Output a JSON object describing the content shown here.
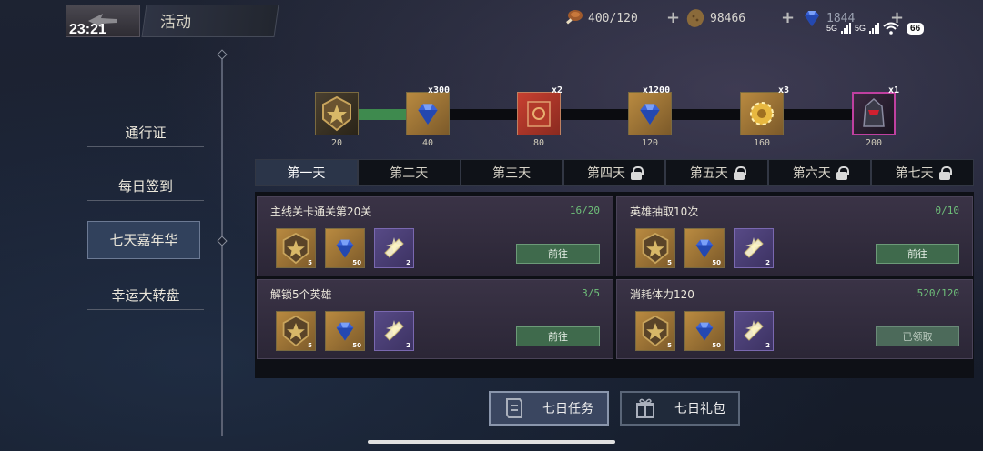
{
  "status_bar": {
    "time": "23:21",
    "network1": "5G",
    "network2": "5G",
    "battery": "66"
  },
  "header": {
    "title": "活动"
  },
  "resources": [
    {
      "icon": "meat-icon",
      "value": "400/120"
    },
    {
      "icon": "potato-coin-icon",
      "value": "98466"
    },
    {
      "icon": "diamond-icon",
      "value": "1844"
    }
  ],
  "sidebar": {
    "items": [
      {
        "label": "通行证",
        "active": false
      },
      {
        "label": "每日签到",
        "active": false
      },
      {
        "label": "七天嘉年华",
        "active": true
      },
      {
        "label": "幸运大转盘",
        "active": false
      }
    ]
  },
  "milestones": [
    {
      "icon": "star-medal-icon",
      "mult": "",
      "points": "20"
    },
    {
      "icon": "diamond-icon",
      "mult": "x300",
      "points": "40"
    },
    {
      "icon": "red-book-icon",
      "mult": "x2",
      "points": "80"
    },
    {
      "icon": "diamond-icon",
      "mult": "x1200",
      "points": "120"
    },
    {
      "icon": "gold-gear-icon",
      "mult": "x3",
      "points": "160"
    },
    {
      "icon": "dark-knight-icon",
      "mult": "x1",
      "points": "200"
    }
  ],
  "progress_fraction": 0.1,
  "day_tabs": [
    {
      "label": "第一天",
      "locked": false,
      "active": true
    },
    {
      "label": "第二天",
      "locked": false,
      "active": false
    },
    {
      "label": "第三天",
      "locked": false,
      "active": false
    },
    {
      "label": "第四天",
      "locked": true,
      "active": false
    },
    {
      "label": "第五天",
      "locked": true,
      "active": false
    },
    {
      "label": "第六天",
      "locked": true,
      "active": false
    },
    {
      "label": "第七天",
      "locked": true,
      "active": false
    }
  ],
  "tasks": [
    {
      "name": "主线关卡通关第20关",
      "progress": "16/20",
      "button": "前往",
      "done": false,
      "rewards": [
        {
          "icon": "star-medal-icon",
          "count": "5"
        },
        {
          "icon": "diamond-icon",
          "count": "50"
        },
        {
          "icon": "scroll-icon",
          "count": "2"
        }
      ]
    },
    {
      "name": "英雄抽取10次",
      "progress": "0/10",
      "button": "前往",
      "done": false,
      "rewards": [
        {
          "icon": "star-medal-icon",
          "count": "5"
        },
        {
          "icon": "diamond-icon",
          "count": "50"
        },
        {
          "icon": "scroll-icon",
          "count": "2"
        }
      ]
    },
    {
      "name": "解锁5个英雄",
      "progress": "3/5",
      "button": "前往",
      "done": false,
      "rewards": [
        {
          "icon": "star-medal-icon",
          "count": "5"
        },
        {
          "icon": "diamond-icon",
          "count": "50"
        },
        {
          "icon": "scroll-icon",
          "count": "2"
        }
      ]
    },
    {
      "name": "消耗体力120",
      "progress": "520/120",
      "button": "已领取",
      "done": true,
      "rewards": [
        {
          "icon": "star-medal-icon",
          "count": "5"
        },
        {
          "icon": "diamond-icon",
          "count": "50"
        },
        {
          "icon": "scroll-icon",
          "count": "2"
        }
      ]
    }
  ],
  "bottom_buttons": [
    {
      "label": "七日任务",
      "icon": "quest-scroll-icon",
      "active": true
    },
    {
      "label": "七日礼包",
      "icon": "gift-icon",
      "active": false
    }
  ],
  "colors": {
    "progress_green": "#3e8a4e",
    "progress_text": "#6fc07a",
    "active_tab": "#2b3549"
  }
}
